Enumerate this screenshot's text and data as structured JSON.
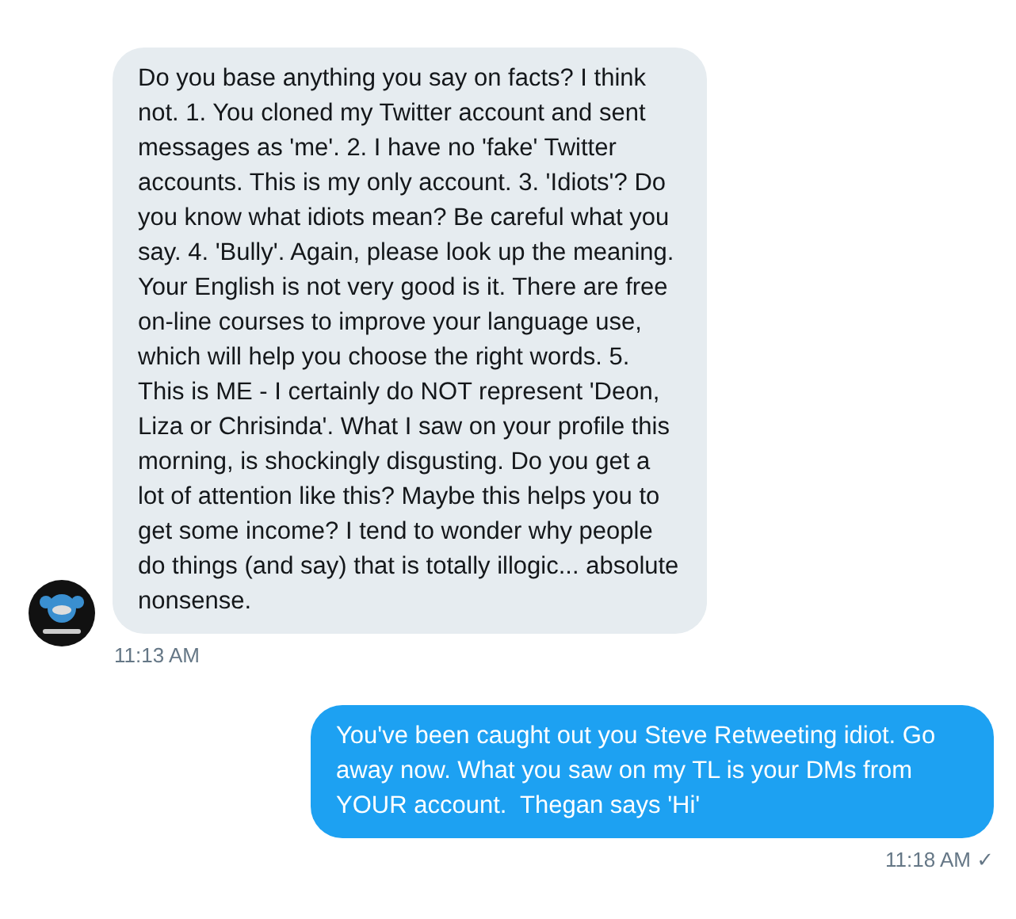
{
  "messages": [
    {
      "kind": "received",
      "text": "Do you base anything you say on facts? I think not. 1. You cloned my Twitter account and sent messages as 'me'. 2. I have no 'fake' Twitter accounts. This is my only account. 3. 'Idiots'? Do you know what idiots mean? Be careful what you say. 4. 'Bully'. Again, please look up the meaning. Your English is not very good is it. There are free on-line courses to improve your language use, which will help you choose the right words. 5. This is ME - I certainly do NOT represent 'Deon, Liza or Chrisinda'. What I saw on your profile this morning, is shockingly disgusting. Do you get a lot of attention like this? Maybe this helps you to get some income? I tend to wonder why people do things (and say) that is totally illogic... absolute nonsense.",
      "time": "11:13 AM"
    },
    {
      "kind": "sent",
      "text": "You've been caught out you Steve Retweeting idiot. Go away now. What you saw on my TL is your DMs from YOUR account.  Thegan says 'Hi'",
      "time": "11:18 AM ✓"
    }
  ]
}
